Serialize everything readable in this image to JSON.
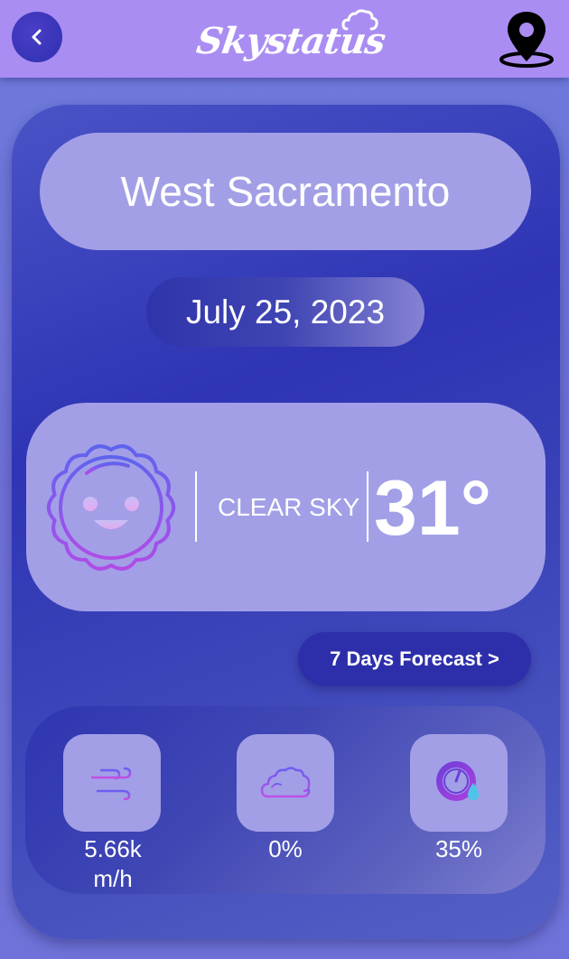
{
  "header": {
    "logo_text": "Skystatus",
    "back_icon": "chevron-left-icon",
    "location_icon": "map-pin-icon"
  },
  "location": {
    "city": "West Sacramento",
    "date": "July 25, 2023"
  },
  "current": {
    "condition": "CLEAR SKY",
    "temperature": "31°",
    "icon": "smiling-sun-icon"
  },
  "forecast_button": {
    "label": "7 Days Forecast >"
  },
  "stats": [
    {
      "icon": "wind-icon",
      "value": "5.66k\nm/h"
    },
    {
      "icon": "cloud-icon",
      "value": "0%"
    },
    {
      "icon": "humidity-gauge-icon",
      "value": "35%"
    }
  ],
  "colors": {
    "header_bg": "#a98df2",
    "card_light": "#a29fe7",
    "card_dark": "#2e34b4",
    "button": "#2d2faa"
  }
}
